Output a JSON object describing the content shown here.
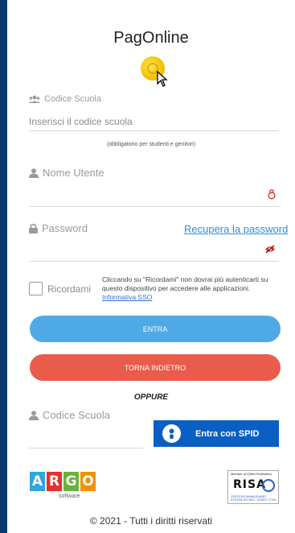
{
  "header": {
    "title": "PagOnline"
  },
  "fields": {
    "school_code": {
      "label": "Codice Scuola",
      "placeholder": "Inserisci il codice scuola",
      "note": "(obbligatorio per studenti e genitori)"
    },
    "username": {
      "label": "Nome Utente",
      "value": ""
    },
    "password": {
      "label": "Password",
      "recover_link": "Recupera la password",
      "value": ""
    }
  },
  "remember": {
    "label": "Ricordami",
    "note": "Cliccando su \"Ricordami\" non dovrai più autenticarti su questo dispositivo per accedere alle applicazioni.",
    "link": "Informativa SSO"
  },
  "buttons": {
    "login": "ENTRA",
    "back": "TORNA INDIETRO"
  },
  "divider": "OPPURE",
  "spid": {
    "label": "Codice Scuola",
    "button": "Entra con SPID"
  },
  "logos": {
    "argo_letters": [
      "A",
      "R",
      "G",
      "O"
    ],
    "argo_colors": [
      "#2ea7df",
      "#e6312d",
      "#67b33a",
      "#f39200"
    ],
    "argo_sub": "software",
    "risa_top": "Member of IQNet Federation",
    "risa_main": "RISA",
    "risa_bottom": "CERTIFIED MANAGEMENT SYSTEM ISO 9001 - ISO/IEC 27001"
  },
  "footer": "© 2021 - Tutti i diritti riservati",
  "colors": {
    "login": "#4ea9e4",
    "back": "#e95b4b",
    "spid": "#0a5fc4",
    "link": "#2f8ed8",
    "sidebar": "#0a3a6b"
  }
}
